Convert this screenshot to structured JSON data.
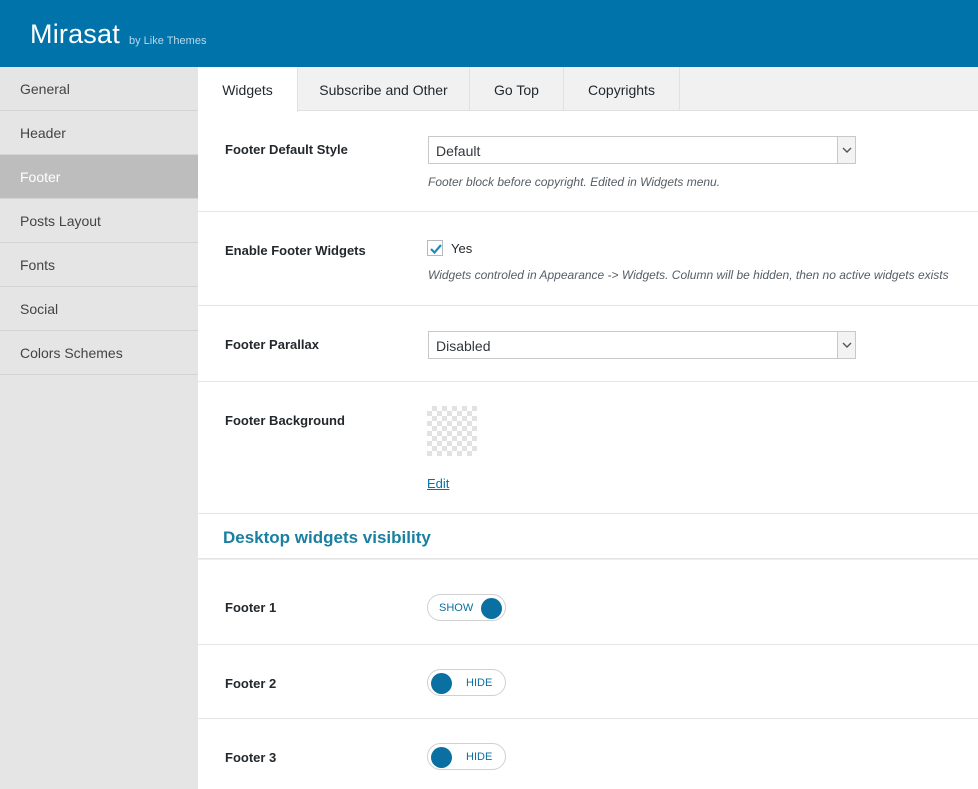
{
  "header": {
    "title": "Mirasat",
    "subtitle": "by Like Themes",
    "bg_color": "#0073aa"
  },
  "sidebar": {
    "items": [
      {
        "label": "General"
      },
      {
        "label": "Header"
      },
      {
        "label": "Footer",
        "active": true
      },
      {
        "label": "Posts Layout"
      },
      {
        "label": "Fonts"
      },
      {
        "label": "Social"
      },
      {
        "label": "Colors Schemes"
      }
    ]
  },
  "tabs": [
    {
      "label": "Widgets",
      "active": true
    },
    {
      "label": "Subscribe and Other"
    },
    {
      "label": "Go Top"
    },
    {
      "label": "Copyrights"
    }
  ],
  "settings": {
    "footer_default_style": {
      "label": "Footer Default Style",
      "value": "Default",
      "description": "Footer block before copyright. Edited in Widgets menu."
    },
    "enable_footer_widgets": {
      "label": "Enable Footer Widgets",
      "checked": true,
      "option_label": "Yes",
      "description": "Widgets controled in Appearance -> Widgets. Column will be hidden, then no active widgets exists"
    },
    "footer_parallax": {
      "label": "Footer Parallax",
      "value": "Disabled"
    },
    "footer_background": {
      "label": "Footer Background",
      "edit_label": "Edit"
    }
  },
  "desktop_visibility": {
    "title": "Desktop widgets visibility",
    "accent_color": "#0a6fa1",
    "items": [
      {
        "label": "Footer 1",
        "state": "SHOW"
      },
      {
        "label": "Footer 2",
        "state": "HIDE"
      },
      {
        "label": "Footer 3",
        "state": "HIDE"
      }
    ]
  }
}
